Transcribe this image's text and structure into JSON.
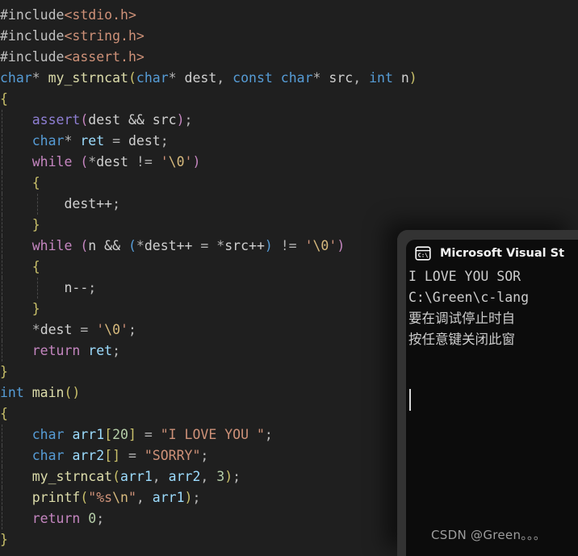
{
  "editor": {
    "background_color": "#1f1f1f",
    "language": "c",
    "code_text": "#include<stdio.h>\n#include<string.h>\n#include<assert.h>\nchar* my_strncat(char* dest, const char* src, int n)\n{\n\tassert(dest && src);\n\tchar* ret = dest;\n\twhile (*dest != '\\0')\n\t{\n\t\tdest++;\n\t}\n\twhile (n && (*dest++ = *src++) != '\\0')\n\t{\n\t\tn--;\n\t}\n\t*dest = '\\0';\n\treturn ret;\n}\nint main()\n{\n\tchar arr1[20] = \"I LOVE YOU \";\n\tchar arr2[] = \"SORRY\";\n\tmy_strncat(arr1, arr2, 3);\n\tprintf(\"%s\\n\", arr1);\n\treturn 0;\n}",
    "lines": [
      "#include<stdio.h>",
      "#include<string.h>",
      "#include<assert.h>",
      "char* my_strncat(char* dest, const char* src, int n)",
      "{",
      "    assert(dest && src);",
      "    char* ret = dest;",
      "    while (*dest != '\\0')",
      "    {",
      "        dest++;",
      "    }",
      "    while (n && (*dest++ = *src++) != '\\0')",
      "    {",
      "        n--;",
      "    }",
      "    *dest = '\\0';",
      "    return ret;",
      "}",
      "int main()",
      "{",
      "    char arr1[20] = \"I LOVE YOU \";",
      "    char arr2[] = \"SORRY\";",
      "    my_strncat(arr1, arr2, 3);",
      "    printf(\"%s\\n\", arr1);",
      "    return 0;",
      "}"
    ],
    "token_colors": {
      "keyword": "#569cd6",
      "control": "#c586c0",
      "function": "#dcdcaa",
      "variable": "#9cdcfe",
      "number": "#b5cea8",
      "string": "#ce9178",
      "escape": "#d7ba7d",
      "macro": "#8f7fd4",
      "plain": "#d0d0d0",
      "brace": "#c9c06a"
    }
  },
  "console": {
    "window_title": "Microsoft Visual St",
    "icon": "cmd-prompt-icon",
    "tab_background": "#0c0c0c",
    "frame_background": "#333333",
    "output_lines": [
      "I LOVE YOU SOR",
      "",
      "C:\\Green\\c-lang",
      "要在调试停止时自",
      "按任意键关闭此窗"
    ],
    "cursor_visible": true
  },
  "watermark": {
    "text": "CSDN @Green。。。"
  }
}
